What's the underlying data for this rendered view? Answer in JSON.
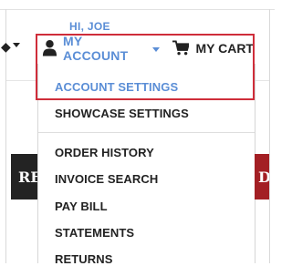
{
  "header": {
    "greeting": "HI, JOE",
    "account_label": "MY ACCOUNT",
    "cart_label": "MY CART",
    "icons": {
      "account": "user-icon",
      "cart": "shopping-cart-icon",
      "account_caret": "chevron-down-icon",
      "left_caret": "chevron-down-icon"
    }
  },
  "account_menu": {
    "items": [
      {
        "label": "ACCOUNT SETTINGS",
        "active": true
      },
      {
        "label": "SHOWCASE SETTINGS"
      },
      {
        "label": "ORDER HISTORY"
      },
      {
        "label": "INVOICE SEARCH"
      },
      {
        "label": "PAY BILL"
      },
      {
        "label": "STATEMENTS"
      },
      {
        "label": "RETURNS"
      }
    ]
  },
  "page_fragments": {
    "left_banner_text": "RE",
    "right_banner_text": "D"
  },
  "colors": {
    "accent": "#5b8ed6",
    "highlight_border": "#cf2d3a",
    "text": "#222222",
    "dark_banner": "#232323",
    "red_banner": "#a31f24"
  }
}
